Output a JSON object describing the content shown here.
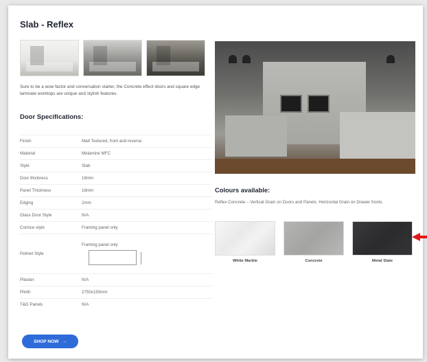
{
  "product": {
    "title": "Slab - Reflex",
    "description": "Sure to be a wow factor and conversation starter, the Concrete effect doors and square edge laminate worktops are unique and stylish features."
  },
  "specs": {
    "heading": "Door Specifications:",
    "rows": [
      {
        "label": "Finish",
        "value": "Matt Textured, front and reverse"
      },
      {
        "label": "Material",
        "value": "Melamine MFC"
      },
      {
        "label": "Style",
        "value": "Slab"
      },
      {
        "label": "Door thickness",
        "value": "18mm"
      },
      {
        "label": "Panel Thickness",
        "value": "18mm"
      },
      {
        "label": "Edging",
        "value": "2mm"
      },
      {
        "label": "Glass Door Style",
        "value": "N/A"
      },
      {
        "label": "Cornice style",
        "value": "Framing panel only"
      },
      {
        "label": "Pelmet Style",
        "value": "Framing panel only"
      },
      {
        "label": "Pilaster",
        "value": "N/A"
      },
      {
        "label": "Plinth",
        "value": "2750x150mm"
      },
      {
        "label": "T&G Panels",
        "value": "N/A"
      }
    ]
  },
  "colours": {
    "heading": "Colours available:",
    "description": "Reflex Concrete – Vertical Grain on Doors and Panels. Horizontal Grain on Drawer fronts.",
    "swatches": [
      {
        "name": "White Marble",
        "color": "#eeeeef"
      },
      {
        "name": "Concrete",
        "color": "#afafad"
      },
      {
        "name": "Metal Slate",
        "color": "#333335"
      }
    ]
  },
  "shop_button": {
    "label": "SHOP NOW",
    "icon": "arrow-right-icon"
  },
  "annotation": {
    "color": "#e01818",
    "icon": "arrow-left-icon"
  }
}
